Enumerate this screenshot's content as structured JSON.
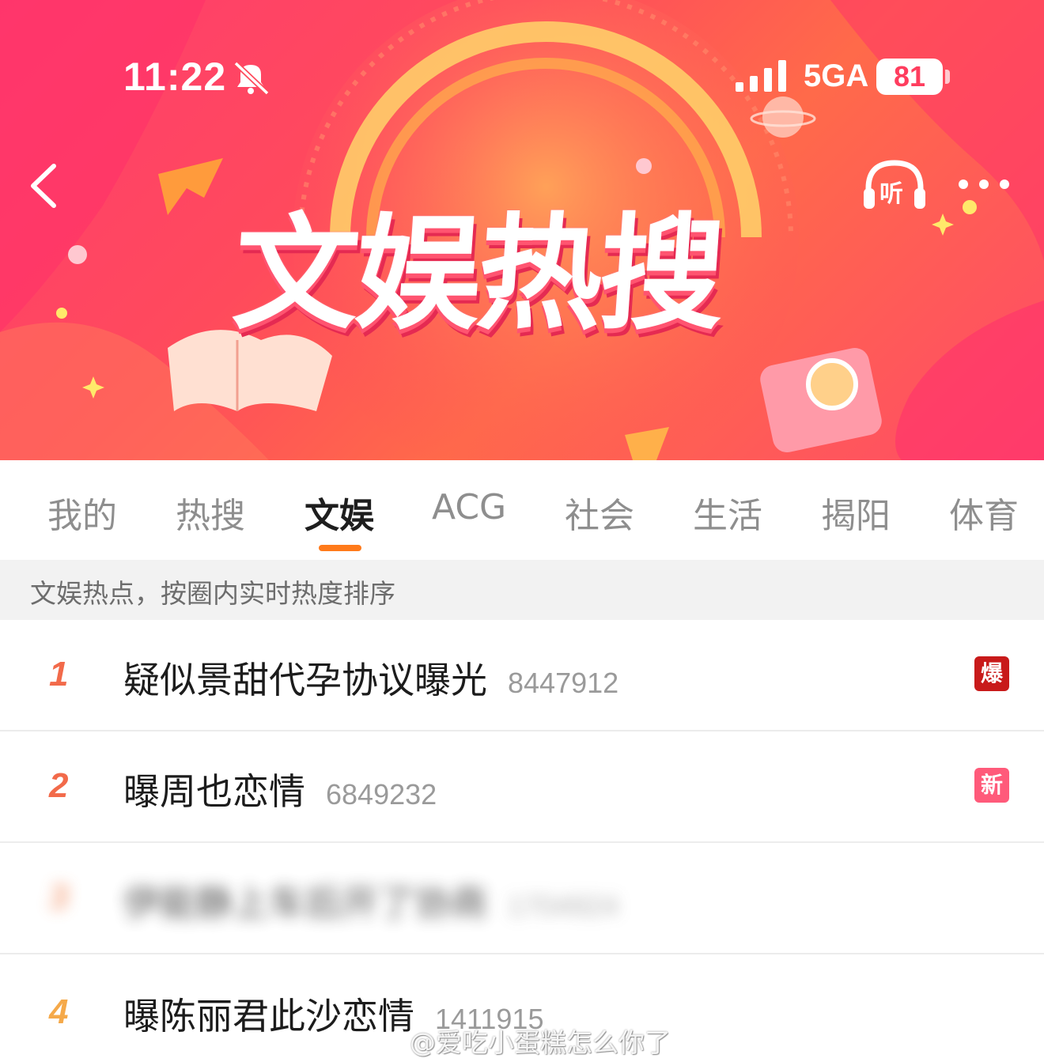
{
  "status_bar": {
    "time": "11:22",
    "network": "5GA",
    "battery": "81"
  },
  "header": {
    "title": "文娱热搜",
    "listen_label": "听"
  },
  "tabs": [
    {
      "label": "我的",
      "active": false
    },
    {
      "label": "热搜",
      "active": false
    },
    {
      "label": "文娱",
      "active": true
    },
    {
      "label": "ACG",
      "active": false
    },
    {
      "label": "社会",
      "active": false
    },
    {
      "label": "生活",
      "active": false
    },
    {
      "label": "揭阳",
      "active": false
    },
    {
      "label": "体育",
      "active": false
    }
  ],
  "hint": "文娱热点，按圈内实时热度排序",
  "list": [
    {
      "rank": "1",
      "title": "疑似景甜代孕协议曝光",
      "heat": "8447912",
      "tag": "爆",
      "rank_color": "#f26a4a",
      "tag_color": "#c81a1a"
    },
    {
      "rank": "2",
      "title": "曝周也恋情",
      "heat": "6849232",
      "tag": "新",
      "rank_color": "#f26a4a",
      "tag_color": "#ff5a7a"
    },
    {
      "rank": "3",
      "title": "伊能静上车后开了协商",
      "heat": "1704924",
      "tag": "",
      "rank_color": "#f28a5a",
      "tag_color": ""
    },
    {
      "rank": "4",
      "title": "曝陈丽君此沙恋情",
      "heat": "1411915",
      "tag": "",
      "rank_color": "#f5a94a",
      "tag_color": ""
    }
  ],
  "watermark": "@爱吃小蛋糕怎么你了",
  "colors": {
    "accent": "#ff7a1a",
    "banner": "#ff4a5c"
  }
}
